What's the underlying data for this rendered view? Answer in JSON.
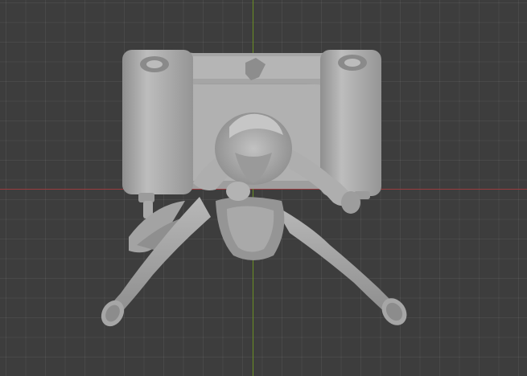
{
  "viewport": {
    "view": "top-orthographic",
    "background_color": "#3d3d3d",
    "grid": true,
    "x_axis_color": "#9a3b3f",
    "y_axis_color": "#6a8e23",
    "model_color": "#a9a9a9",
    "model_shadow_color": "#7c7c7c",
    "model_highlight_color": "#c4c4c4"
  }
}
